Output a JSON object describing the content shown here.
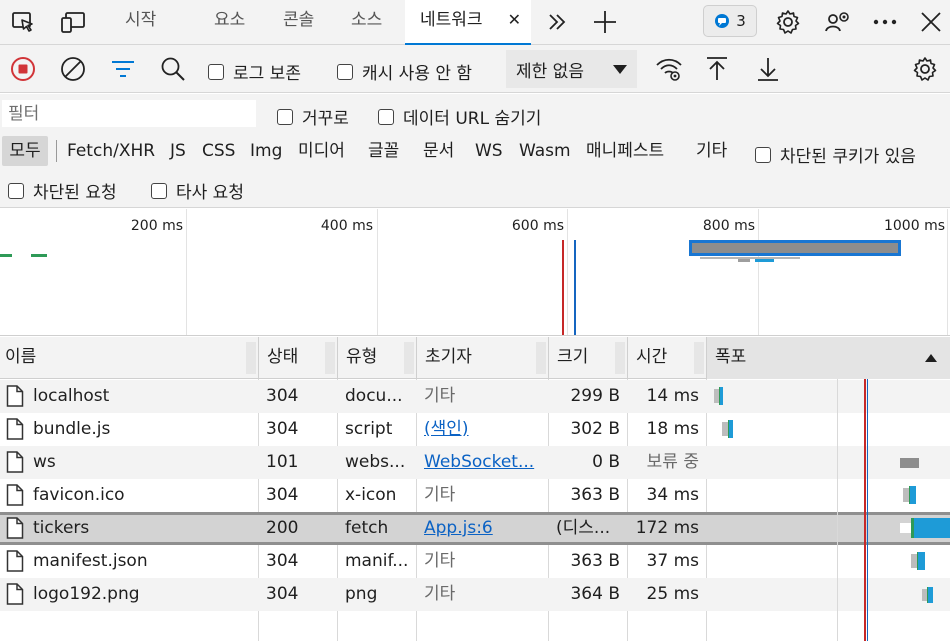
{
  "tabs": {
    "welcome": "시작",
    "elements": "요소",
    "console": "콘솔",
    "sources": "소스",
    "network": "네트워크",
    "network_close": "✕",
    "issues_count": "3"
  },
  "toolbar": {
    "preserve_log": "로그 보존",
    "disable_cache": "캐시 사용 안 함",
    "throttling": "제한 없음"
  },
  "filter": {
    "placeholder": "필터",
    "invert": "거꾸로",
    "hide_data_urls": "데이터 URL 숨기기",
    "types": [
      "모두",
      "Fetch/XHR",
      "JS",
      "CSS",
      "Img",
      "미디어",
      "글꼴",
      "문서",
      "WS",
      "Wasm",
      "매니페스트",
      "기타"
    ],
    "blocked_cookies": "차단된 쿠키가 있음",
    "blocked_requests": "차단된 요청",
    "third_party": "타사 요청"
  },
  "overview": {
    "labels": [
      "200 ms",
      "400 ms",
      "600 ms",
      "800 ms",
      "1000 ms"
    ]
  },
  "table": {
    "headers": [
      "이름",
      "상태",
      "유형",
      "초기자",
      "크기",
      "시간",
      "폭포"
    ],
    "rows": [
      {
        "name": "localhost",
        "status": "304",
        "type": "docu...",
        "initiator": "기타",
        "size": "299 B",
        "time": "14 ms"
      },
      {
        "name": "bundle.js",
        "status": "304",
        "type": "script",
        "initiator": "(색인)",
        "size": "302 B",
        "time": "18 ms"
      },
      {
        "name": "ws",
        "status": "101",
        "type": "webs...",
        "initiator": "WebSocket...",
        "size": "0 B",
        "time": "보류 중"
      },
      {
        "name": "favicon.ico",
        "status": "304",
        "type": "x-icon",
        "initiator": "기타",
        "size": "363 B",
        "time": "34 ms"
      },
      {
        "name": "tickers",
        "status": "200",
        "type": "fetch",
        "initiator": "App.js:6",
        "size": "(디스...",
        "time": "172 ms"
      },
      {
        "name": "manifest.json",
        "status": "304",
        "type": "manif...",
        "initiator": "기타",
        "size": "363 B",
        "time": "37 ms"
      },
      {
        "name": "logo192.png",
        "status": "304",
        "type": "png",
        "initiator": "기타",
        "size": "364 B",
        "time": "25 ms"
      }
    ]
  },
  "colors": {
    "accent": "#0078d4",
    "record_red": "#d13438",
    "link": "#0b62c4"
  }
}
